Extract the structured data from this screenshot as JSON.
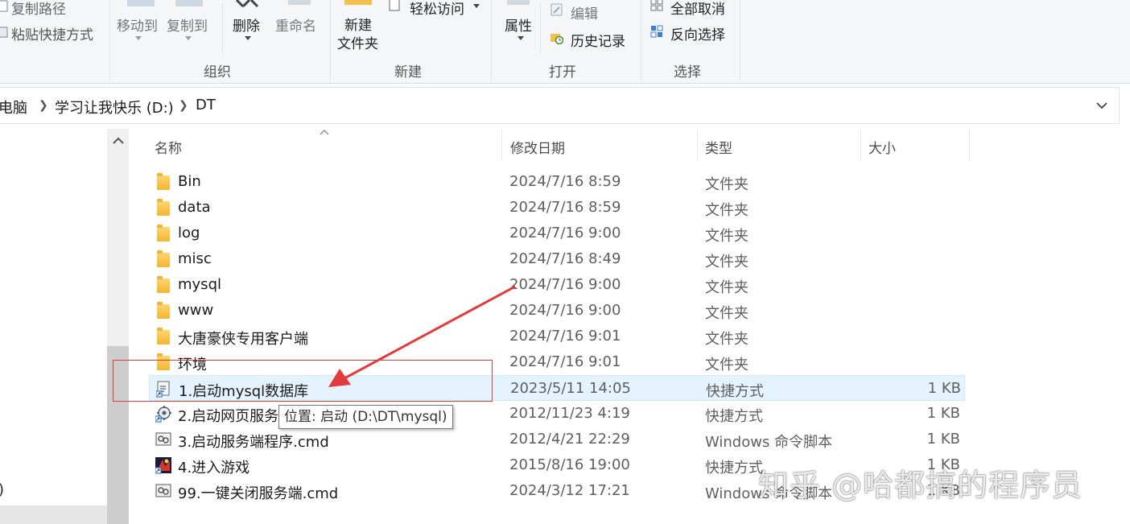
{
  "ribbon": {
    "copy_path": "复制路径",
    "paste_shortcut": "粘贴快捷方式",
    "move_to": "移动到",
    "copy_to": "复制到",
    "delete": "删除",
    "rename": "重命名",
    "group_organize": "组织",
    "new_folder_line1": "新建",
    "new_folder_line2": "文件夹",
    "easy_access": "轻松访问",
    "group_new": "新建",
    "properties": "属性",
    "edit": "编辑",
    "history": "历史记录",
    "group_open": "打开",
    "select_none": "全部取消",
    "invert_selection": "反向选择",
    "group_select": "选择"
  },
  "address": {
    "crumbs": [
      "电脑",
      "学习让我快乐 (D:)",
      "DT"
    ]
  },
  "nav": {
    "partial_label": ")"
  },
  "columns": {
    "name": "名称",
    "modified": "修改日期",
    "type": "类型",
    "size": "大小"
  },
  "files": [
    {
      "name": "Bin",
      "modified": "2024/7/16 8:59",
      "type": "文件夹",
      "size": "",
      "icon": "folder-icon"
    },
    {
      "name": "data",
      "modified": "2024/7/16 8:59",
      "type": "文件夹",
      "size": "",
      "icon": "folder-icon"
    },
    {
      "name": "log",
      "modified": "2024/7/16 9:00",
      "type": "文件夹",
      "size": "",
      "icon": "folder-icon"
    },
    {
      "name": "misc",
      "modified": "2024/7/16 8:49",
      "type": "文件夹",
      "size": "",
      "icon": "folder-icon"
    },
    {
      "name": "mysql",
      "modified": "2024/7/16 9:00",
      "type": "文件夹",
      "size": "",
      "icon": "folder-icon"
    },
    {
      "name": "www",
      "modified": "2024/7/16 9:00",
      "type": "文件夹",
      "size": "",
      "icon": "folder-icon"
    },
    {
      "name": "大唐豪侠专用客户端",
      "modified": "2024/7/16 9:01",
      "type": "文件夹",
      "size": "",
      "icon": "folder-icon"
    },
    {
      "name": "环境",
      "modified": "2024/7/16 9:01",
      "type": "文件夹",
      "size": "",
      "icon": "folder-icon"
    },
    {
      "name": "1.启动mysql数据库",
      "modified": "2023/5/11 14:05",
      "type": "快捷方式",
      "size": "1 KB",
      "icon": "shortcut-icon"
    },
    {
      "name": "2.启动网页服务",
      "modified": "2012/11/23 4:19",
      "type": "快捷方式",
      "size": "1 KB",
      "icon": "gear-shortcut-icon"
    },
    {
      "name": "3.启动服务端程序.cmd",
      "modified": "2012/4/21 22:29",
      "type": "Windows 命令脚本",
      "size": "1 KB",
      "icon": "cmd-icon"
    },
    {
      "name": "4.进入游戏",
      "modified": "2015/8/16 19:00",
      "type": "快捷方式",
      "size": "1 KB",
      "icon": "game-icon"
    },
    {
      "name": "99.一键关闭服务端.cmd",
      "modified": "2024/3/12 17:21",
      "type": "Windows 命令脚本",
      "size": "1 KB",
      "icon": "cmd-icon"
    }
  ],
  "tooltip": "位置: 启动 (D:\\DT\\mysql)",
  "watermark": "知乎 @哈都搞的程序员",
  "colors": {
    "selection": "#e5f3ff",
    "annotation_red": "#e23b3b",
    "folder_yellow": "#f2b632"
  }
}
